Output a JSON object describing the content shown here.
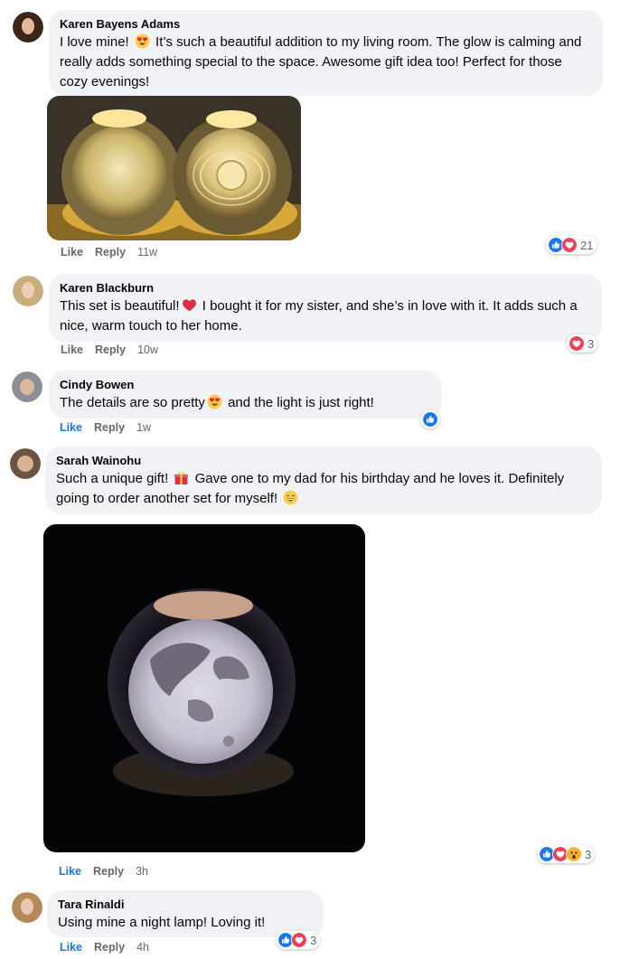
{
  "comments": [
    {
      "author": "Karen Bayens Adams",
      "text_1": "I love mine! ",
      "text_2": " It’s such a beautiful addition to my living room. The glow is calming and really adds something special to the space. Awesome gift idea too! Perfect for those cozy evenings!",
      "like": "Like",
      "reply": "Reply",
      "time": "11w",
      "reaction_count": "21",
      "reactions": [
        "like-icon",
        "love-icon"
      ]
    },
    {
      "author": "Karen Blackburn",
      "text_1": "This set is beautiful!",
      "text_2": " I bought it for my sister, and she’s in love with it. It adds such a nice, warm touch to her home.",
      "like": "Like",
      "reply": "Reply",
      "time": "10w",
      "reaction_count": "3",
      "reactions": [
        "love-icon"
      ]
    },
    {
      "author": "Cindy Bowen",
      "text_1": "The details are so pretty",
      "text_2": " and the light is just right!",
      "like": "Like",
      "reply": "Reply",
      "time": "1w",
      "reactions": [
        "like-icon"
      ]
    },
    {
      "author": "Sarah Wainohu",
      "text_1": "Such a unique gift! ",
      "text_2": " Gave one to my dad for his birthday and he loves it. Definitely going to order another set for myself! ",
      "like": "Like",
      "reply": "Reply",
      "time": "3h",
      "reaction_count": "3",
      "reactions": [
        "like-icon",
        "love-icon",
        "wow-icon"
      ]
    },
    {
      "author": "Tara Rinaldi",
      "text_1": "Using mine a night lamp! Loving it!",
      "like": "Like",
      "reply": "Reply",
      "time": "4h",
      "reaction_count": "3",
      "reactions": [
        "like-icon",
        "love-icon"
      ]
    }
  ],
  "colors": {
    "bubble": "#f0f2f5",
    "meta_text": "#65676b",
    "like_blue": "#1877f2",
    "love_red": "#f33e58",
    "wow_yellow": "#f7b125"
  }
}
